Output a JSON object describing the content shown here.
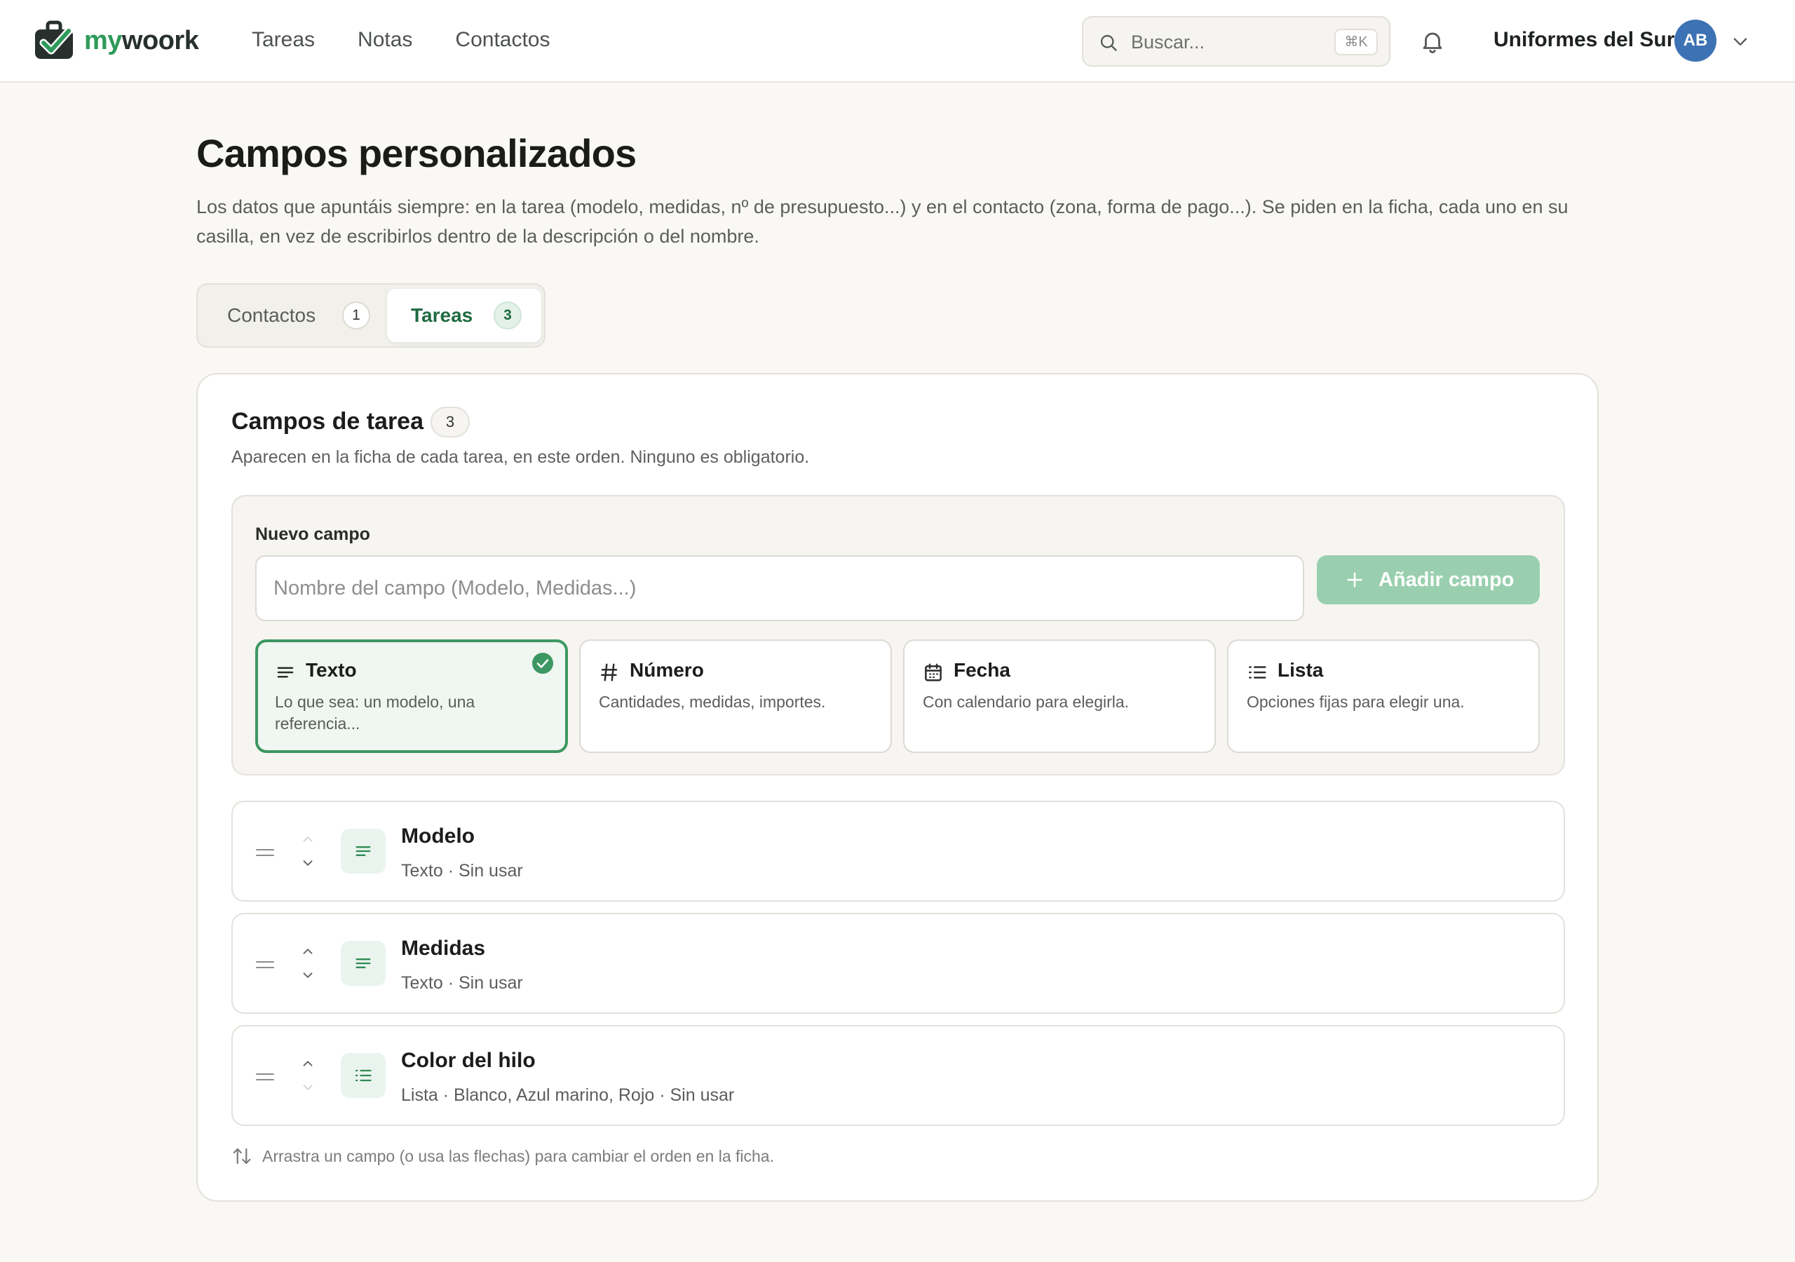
{
  "brand": {
    "prefix": "my",
    "suffix": "woork"
  },
  "nav": {
    "items": [
      "Tareas",
      "Notas",
      "Contactos"
    ]
  },
  "search": {
    "placeholder": "Buscar...",
    "shortcut": "⌘K"
  },
  "account": {
    "org_name": "Uniformes del Sur",
    "avatar_initials": "AB"
  },
  "page": {
    "title": "Campos personalizados",
    "description": "Los datos que apuntáis siempre: en la tarea (modelo, medidas, nº de presupuesto...) y en el contacto (zona, forma de pago...). Se piden en la ficha, cada uno en su casilla, en vez de escribirlos dentro de la descripción o del nombre."
  },
  "tabs": [
    {
      "label": "Contactos",
      "count": "1",
      "active": false
    },
    {
      "label": "Tareas",
      "count": "3",
      "active": true
    }
  ],
  "card": {
    "title": "Campos de tarea",
    "count": "3",
    "description": "Aparecen en la ficha de cada tarea, en este orden. Ninguno es obligatorio."
  },
  "new_field": {
    "label": "Nuevo campo",
    "placeholder": "Nombre del campo (Modelo, Medidas...)",
    "value": "",
    "add_button": "Añadir campo",
    "types": [
      {
        "name": "Texto",
        "description": "Lo que sea: un modelo, una referencia...",
        "icon": "text-lines-icon",
        "selected": true
      },
      {
        "name": "Número",
        "description": "Cantidades, medidas, importes.",
        "icon": "hash-icon",
        "selected": false
      },
      {
        "name": "Fecha",
        "description": "Con calendario para elegirla.",
        "icon": "calendar-icon",
        "selected": false
      },
      {
        "name": "Lista",
        "description": "Opciones fijas para elegir una.",
        "icon": "list-icon",
        "selected": false
      }
    ]
  },
  "fields": [
    {
      "name": "Modelo",
      "meta": "Texto · Sin usar",
      "icon": "text-lines-icon"
    },
    {
      "name": "Medidas",
      "meta": "Texto · Sin usar",
      "icon": "text-lines-icon"
    },
    {
      "name": "Color del hilo",
      "meta": "Lista · Blanco, Azul marino, Rojo · Sin usar",
      "icon": "list-icon"
    }
  ],
  "footer_hint": "Arrastra un campo (o usa las flechas) para cambiar el orden en la ficha.",
  "colors": {
    "accent": "#2f9a5a",
    "accent_dark": "#1f6b41",
    "button_disabled": "#99cfae",
    "avatar": "#3d72b4",
    "background": "#f9f8f5"
  }
}
